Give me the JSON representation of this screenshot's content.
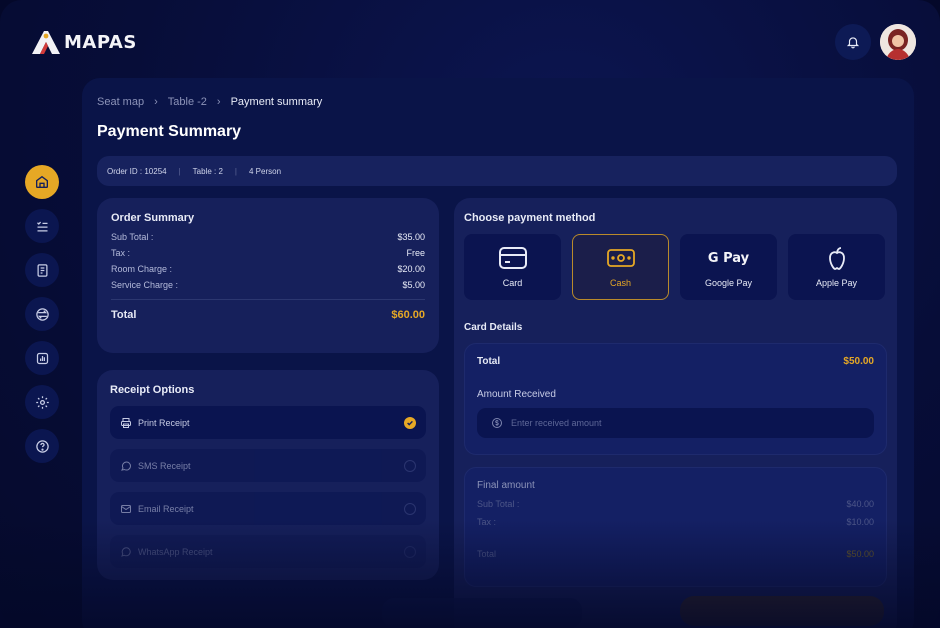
{
  "app": {
    "name": "MAPAS"
  },
  "breadcrumb": [
    "Seat map",
    "Table -2",
    "Payment summary"
  ],
  "page_title": "Payment Summary",
  "order_bar": {
    "order_id": "Order ID : 10254",
    "table": "Table : 2",
    "persons": "4 Person"
  },
  "order_summary": {
    "title": "Order Summary",
    "rows": [
      {
        "label": "Sub Total :",
        "value": "$35.00"
      },
      {
        "label": "Tax :",
        "value": "Free"
      },
      {
        "label": "Room Charge :",
        "value": "$20.00"
      },
      {
        "label": "Service Charge :",
        "value": "$5.00"
      }
    ],
    "total_label": "Total",
    "total_value": "$60.00"
  },
  "receipt_options": {
    "title": "Receipt Options",
    "items": [
      "Print Receipt",
      "SMS Receipt",
      "Email Receipt",
      "WhatsApp Receipt"
    ]
  },
  "payment": {
    "title": "Choose payment method",
    "methods": [
      "Card",
      "Cash",
      "Google Pay",
      "Apple Pay"
    ],
    "gpay_logo": "G Pay",
    "card_details_title": "Card Details",
    "total_label": "Total",
    "total_value": "$50.00",
    "amount_received_label": "Amount Received",
    "amount_placeholder": "Enter received amount",
    "final": {
      "title": "Final amount",
      "rows": [
        {
          "label": "Sub Total :",
          "value": "$40.00"
        },
        {
          "label": "Tax :",
          "value": "$10.00"
        }
      ],
      "total_label": "Total",
      "total_value": "$50.00"
    }
  },
  "colors": {
    "accent": "#e6a825",
    "background": "#050a2c",
    "panel": "#0a1448",
    "card": "#16205b"
  },
  "icons": {
    "sidebar": [
      "dashboard-icon",
      "list-icon",
      "orders-icon",
      "swap-icon",
      "report-icon",
      "settings-icon",
      "help-icon"
    ],
    "header": [
      "bell-icon",
      "avatar"
    ]
  }
}
